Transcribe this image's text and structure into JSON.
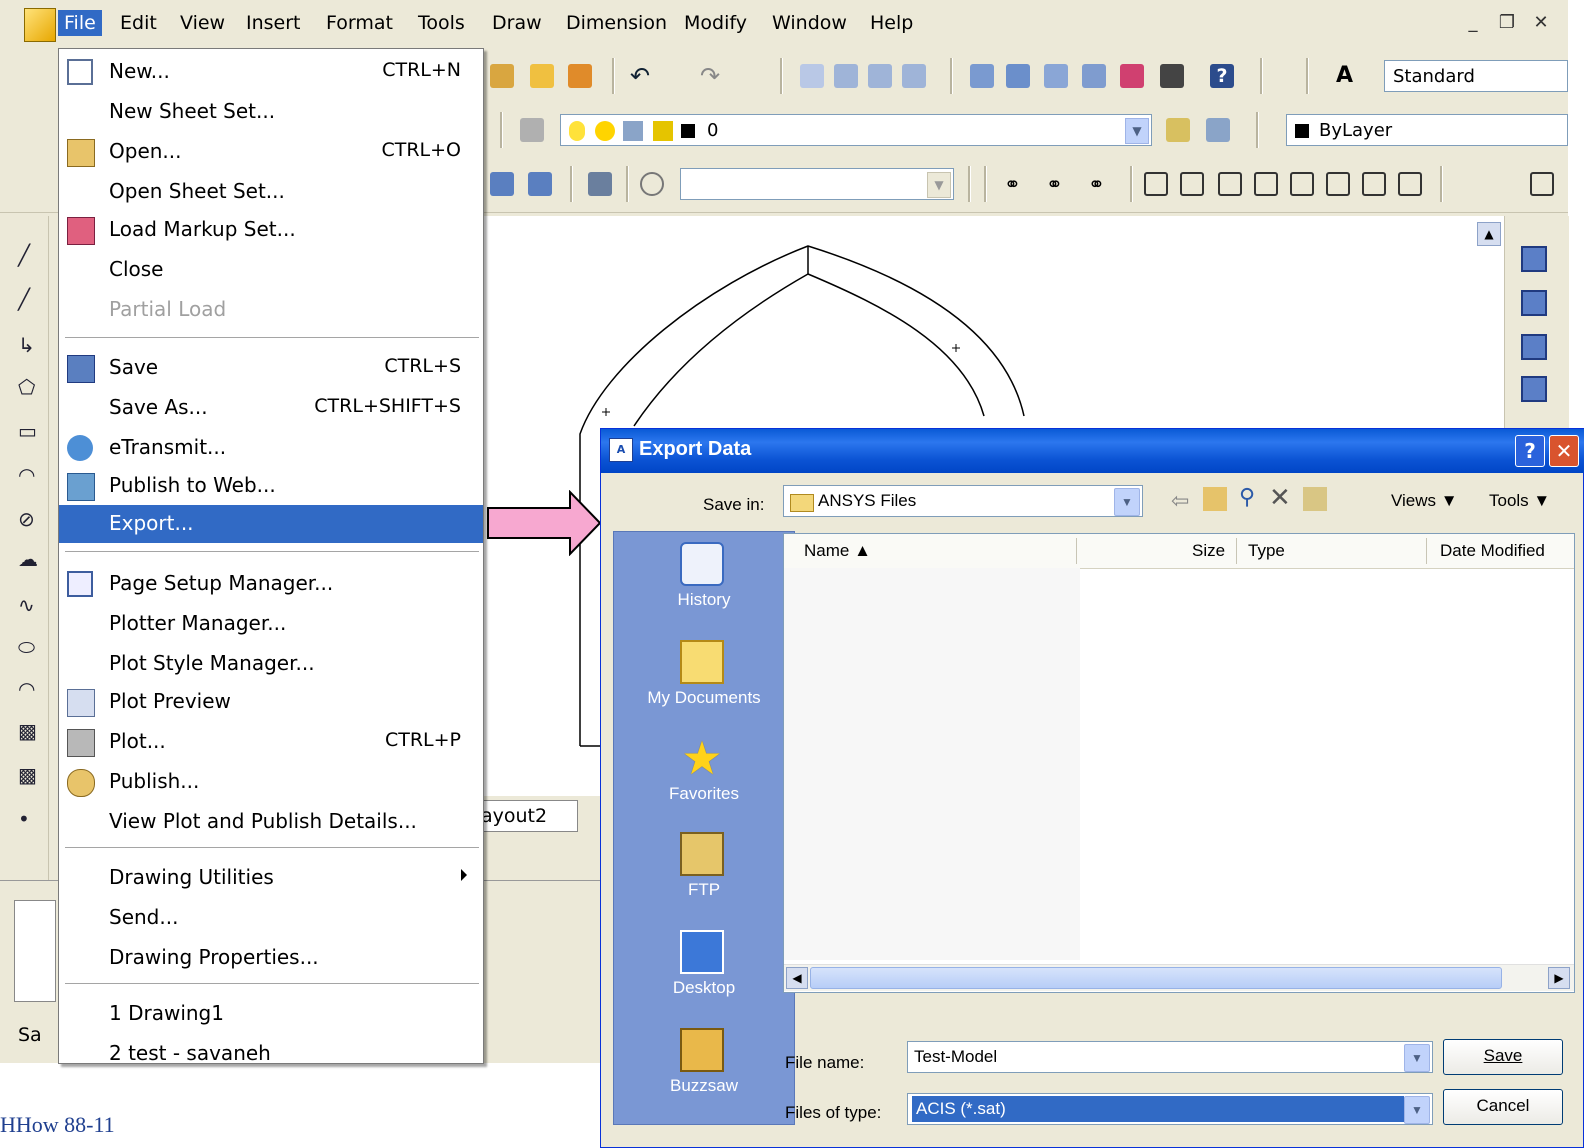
{
  "menubar": {
    "items": [
      "File",
      "Edit",
      "View",
      "Insert",
      "Format",
      "Tools",
      "Draw",
      "Dimension",
      "Modify",
      "Window",
      "Help"
    ]
  },
  "toolbar": {
    "text_style": "Standard",
    "layer": "0",
    "color": "ByLayer"
  },
  "file_menu": {
    "items": [
      {
        "label": "New...",
        "shortcut": "CTRL+N"
      },
      {
        "label": "New Sheet Set...",
        "shortcut": ""
      },
      {
        "label": "Open...",
        "shortcut": "CTRL+O"
      },
      {
        "label": "Open Sheet Set...",
        "shortcut": ""
      },
      {
        "label": "Load Markup Set...",
        "shortcut": ""
      },
      {
        "label": "Close",
        "shortcut": ""
      },
      {
        "label": "Partial Load",
        "shortcut": ""
      },
      {
        "label": "Save",
        "shortcut": "CTRL+S"
      },
      {
        "label": "Save As...",
        "shortcut": "CTRL+SHIFT+S"
      },
      {
        "label": "eTransmit...",
        "shortcut": ""
      },
      {
        "label": "Publish to Web...",
        "shortcut": ""
      },
      {
        "label": "Export...",
        "shortcut": ""
      },
      {
        "label": "Page Setup Manager...",
        "shortcut": ""
      },
      {
        "label": "Plotter Manager...",
        "shortcut": ""
      },
      {
        "label": "Plot Style Manager...",
        "shortcut": ""
      },
      {
        "label": "Plot Preview",
        "shortcut": ""
      },
      {
        "label": "Plot...",
        "shortcut": "CTRL+P"
      },
      {
        "label": "Publish...",
        "shortcut": ""
      },
      {
        "label": "View Plot and Publish Details...",
        "shortcut": ""
      },
      {
        "label": "Drawing Utilities",
        "shortcut": ""
      },
      {
        "label": "Send...",
        "shortcut": ""
      },
      {
        "label": "Drawing Properties...",
        "shortcut": ""
      },
      {
        "label": "1 Drawing1",
        "shortcut": ""
      },
      {
        "label": "2 test - savaneh",
        "shortcut": ""
      }
    ]
  },
  "layout_tab": "ayout2",
  "status_text": "Sa",
  "dialog": {
    "title": "Export Data",
    "save_in_label": "Save in:",
    "save_in_value": "ANSYS Files",
    "views_label": "Views",
    "tools_label": "Tools",
    "columns": {
      "name": "Name",
      "size": "Size",
      "type": "Type",
      "date": "Date Modified"
    },
    "places": [
      "History",
      "My Documents",
      "Favorites",
      "FTP",
      "Desktop",
      "Buzzsaw"
    ],
    "file_name_label": "File name:",
    "file_name_value": "Test-Model",
    "file_type_label": "Files of type:",
    "file_type_value": "ACIS (*.sat)",
    "save_button": "Save",
    "cancel_button": "Cancel"
  },
  "footer": "HHow 88-11",
  "colors": {
    "accent": "#316ac5",
    "title_bar": "#0a5ad6",
    "arrow_fill": "#f7a8d0"
  }
}
